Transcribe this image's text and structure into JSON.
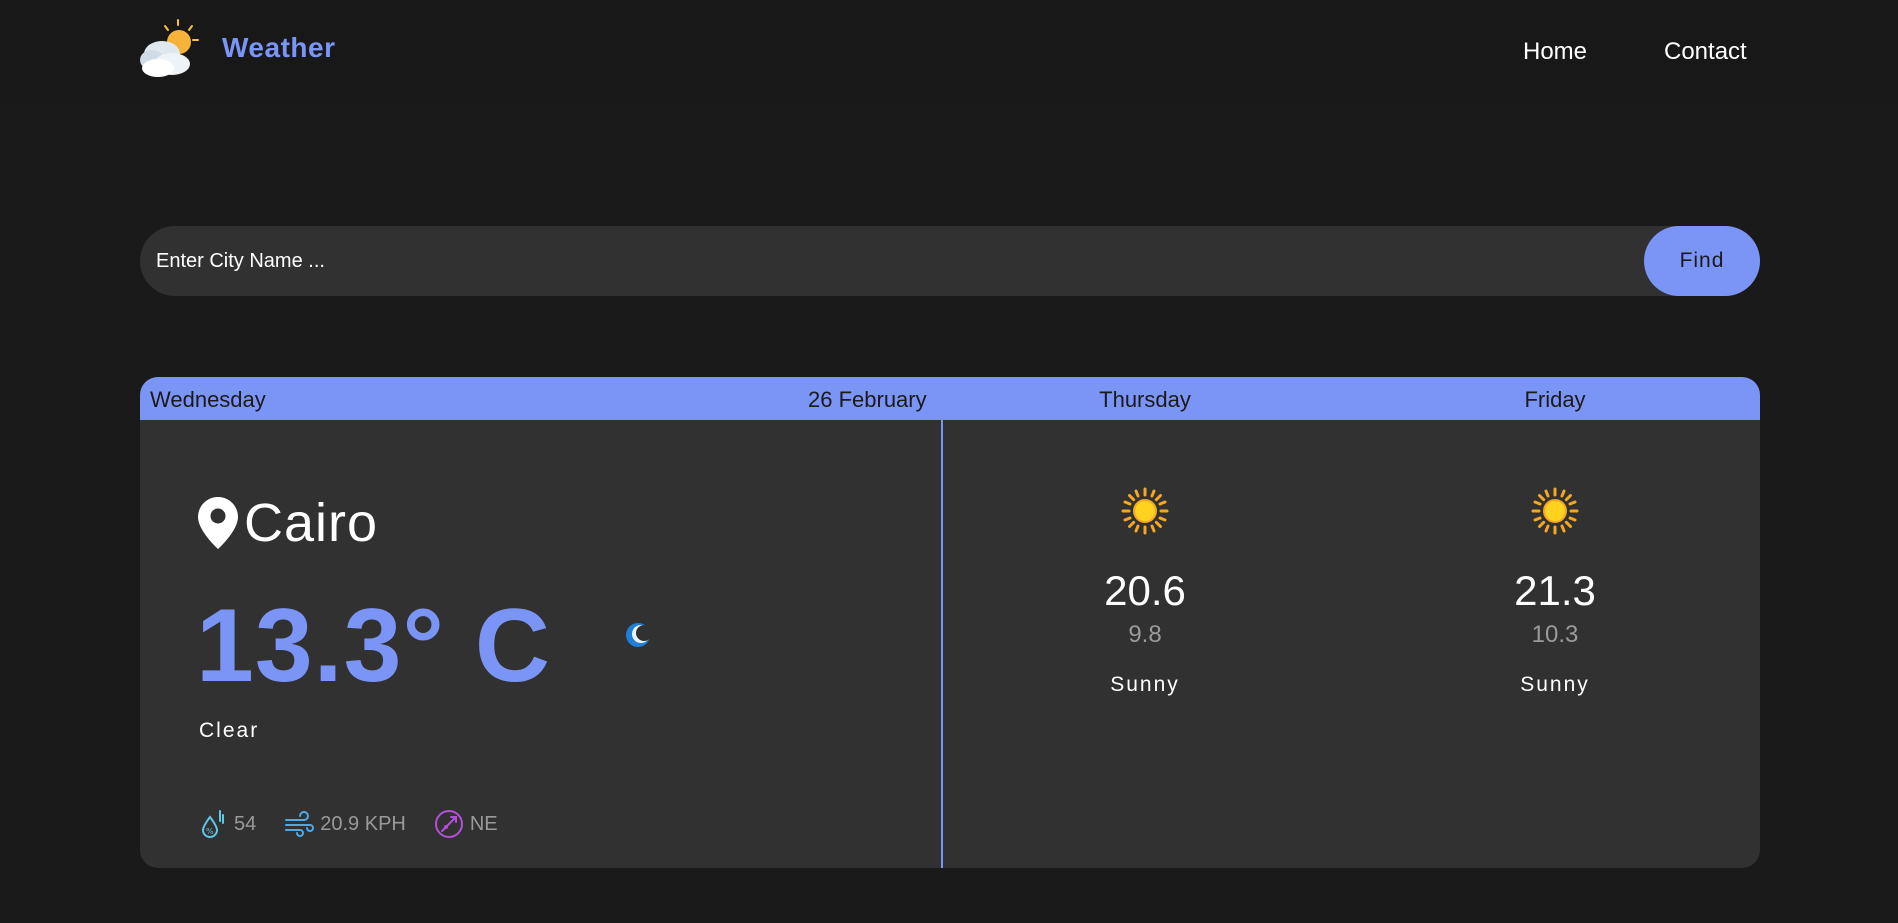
{
  "navbar": {
    "brand": "Weather",
    "links": [
      {
        "label": "Home"
      },
      {
        "label": "Contact"
      }
    ]
  },
  "search": {
    "placeholder": "Enter City Name ...",
    "value": "",
    "button_label": "Find"
  },
  "today": {
    "day": "Wednesday",
    "date": "26 February",
    "city": "Cairo",
    "temperature": "13.3° C",
    "condition": "Clear",
    "condition_icon": "moon-icon",
    "stats": {
      "humidity": "54",
      "wind_speed": "20.9 KPH",
      "wind_direction": "NE"
    }
  },
  "forecast": [
    {
      "day": "Thursday",
      "max": "20.6",
      "min": "9.8",
      "condition": "Sunny",
      "icon": "sun-icon"
    },
    {
      "day": "Friday",
      "max": "21.3",
      "min": "10.3",
      "condition": "Sunny",
      "icon": "sun-icon"
    }
  ],
  "colors": {
    "accent": "#7b95f6",
    "background": "#1a1a1a",
    "card": "#313131",
    "muted_text": "#9a9a9a"
  }
}
